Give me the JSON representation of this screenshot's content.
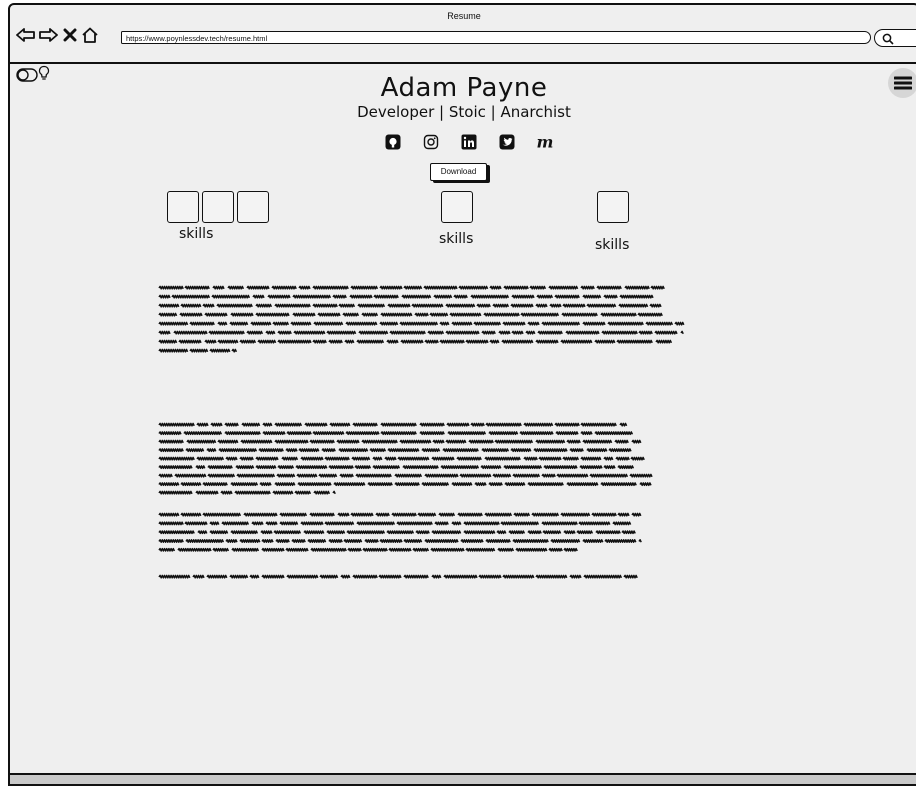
{
  "window": {
    "title": "Resume"
  },
  "browser": {
    "url": "https://www.poynlessdev.tech/resume.html"
  },
  "page": {
    "name": "Adam Payne",
    "tagline": "Developer | Stoic | Anarchist",
    "social_icons": [
      "github-icon",
      "instagram-icon",
      "linkedin-icon",
      "twitter-icon",
      "medium-icon"
    ],
    "download_label": "Download",
    "skills": [
      {
        "label": "skills",
        "boxes": 3
      },
      {
        "label": "skills",
        "boxes": 1
      },
      {
        "label": "skills",
        "boxes": 1
      }
    ]
  }
}
